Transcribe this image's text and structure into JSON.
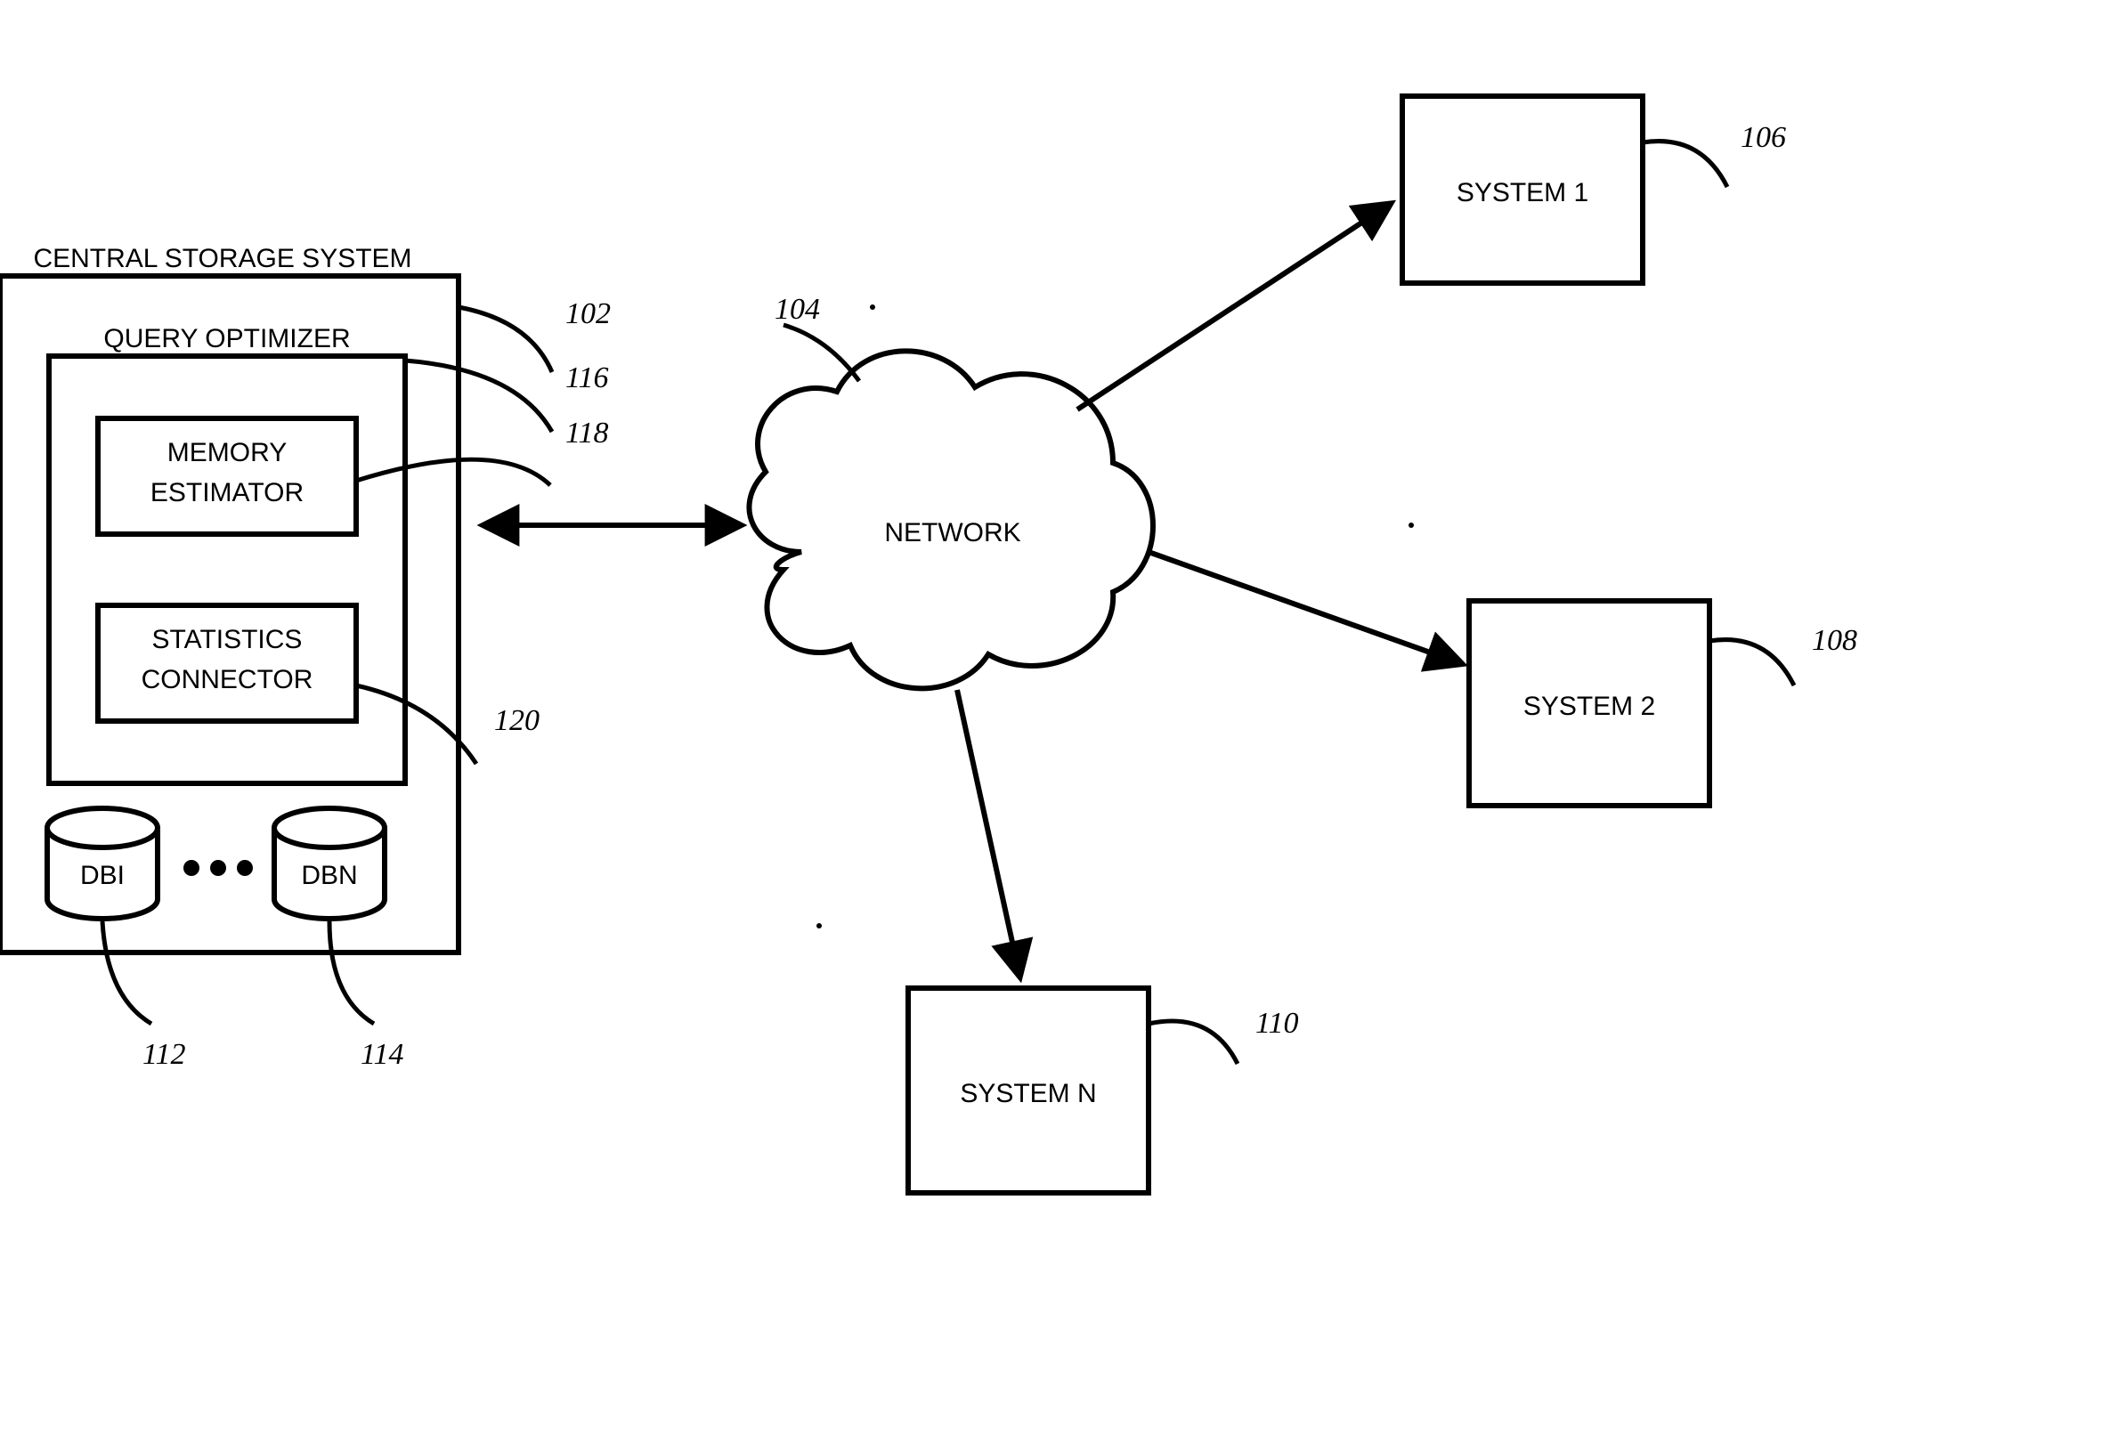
{
  "diagram": {
    "central_storage": {
      "title": "CENTRAL STORAGE SYSTEM",
      "ref": "102",
      "query_optimizer": {
        "title": "QUERY OPTIMIZER",
        "ref": "116",
        "memory_estimator": {
          "label1": "MEMORY",
          "label2": "ESTIMATOR",
          "ref": "118"
        },
        "statistics_connector": {
          "label1": "STATISTICS",
          "label2": "CONNECTOR",
          "ref": "120"
        }
      },
      "db1": {
        "label": "DBI",
        "ref": "112"
      },
      "dbn": {
        "label": "DBN",
        "ref": "114"
      }
    },
    "network": {
      "label": "NETWORK",
      "ref": "104"
    },
    "system1": {
      "label": "SYSTEM 1",
      "ref": "106"
    },
    "system2": {
      "label": "SYSTEM 2",
      "ref": "108"
    },
    "systemN": {
      "label": "SYSTEM N",
      "ref": "110"
    }
  }
}
